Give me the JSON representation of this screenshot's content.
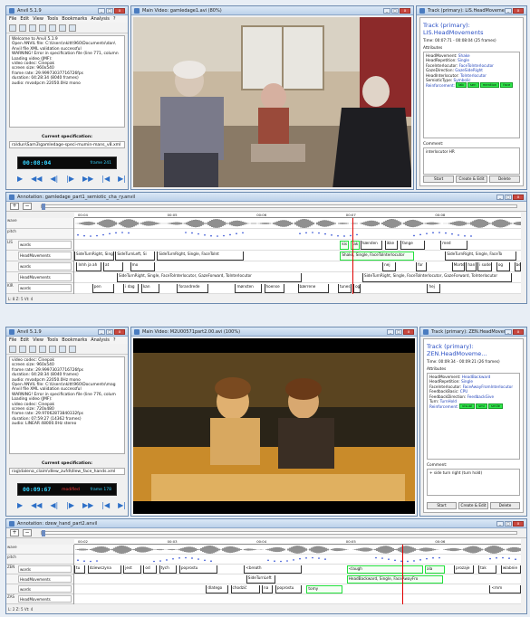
{
  "shots": [
    {
      "control": {
        "title": "Anvil 5.1.9",
        "menu": [
          "File",
          "Edit",
          "View",
          "Tools",
          "Bookmarks",
          "Analysis",
          "?"
        ],
        "log": [
          "Welcome to Anvil 5.1.9",
          "Open ANVIL file: C:\\Users\\nkitt\\960\\Documents\\dan\\",
          "  Anvil file XML validation successful",
          "WARNING! Error in specification file (line 771, column",
          "Loading video (JMF):",
          "   video codec: Cinepak",
          "   screen size: 960x540",
          "   frame rate: 29.99973037716726fps",
          "   duration: 04:28:34 (8040 frames)",
          "   audio: mvadpcm 22050.0Hz mono"
        ],
        "spec_caption": "Current specification:",
        "spec_path": "ra\\dun\\Sam3\\gamledage-speci-mumin-mans_v8.xml",
        "timecode": "00:08:04",
        "frame": "frame 241",
        "status": "",
        "controls": [
          "▶",
          "◀◀",
          "◀|",
          "|▶",
          "▶▶",
          "|◀",
          "▶|"
        ]
      },
      "video": {
        "title": "Main Video: gamledage1.avi (80%)",
        "palette": [
          "#b8a890",
          "#7a6654",
          "#2e2a2a",
          "#d9d2c4",
          "#8c2a2a",
          "#555a66"
        ]
      },
      "track": {
        "title": "Track (primary): LIS.HeadMovements",
        "window_title": "Track (primary): LIS.HeadMovements",
        "time": "Time: 00:07:71 - 00:08:04 (25 frames)",
        "attributes_label": "Attributes",
        "attributes": [
          [
            "HeadMovement:",
            "Shake"
          ],
          [
            "HeadRepetition:",
            "Single"
          ],
          [
            "FaceInterlocutor:",
            "FaceToInterlocutor"
          ],
          [
            "GazeDirection:",
            "GazeSideRight"
          ],
          [
            "HeadInterlocutor:",
            "ToInterlocutor"
          ],
          [
            "SemioticType:",
            "Symbolic"
          ]
        ],
        "reinforcement_label": "Reinforcement:",
        "reinforcement": [
          "lab",
          "sen",
          "mention",
          "face"
        ],
        "comment_label": "Comment:",
        "comment": "interlocutor HR",
        "buttons": [
          "Start",
          "Create & Edit",
          "Delete"
        ]
      },
      "annotation": {
        "title": "Annotation: gamledage_part1_semiotic_cha_ry.anvil",
        "ruler": [
          "00:04",
          "00:05",
          "00:06",
          "00:07",
          "00:08"
        ],
        "tiers": [
          {
            "id": "wave",
            "name": ""
          },
          {
            "id": "pitch",
            "name": ""
          },
          {
            "id": "LIS",
            "name": "words"
          },
          {
            "id": "",
            "name": "HeadMovements"
          },
          {
            "id": "",
            "name": "words"
          },
          {
            "id": "",
            "name": "HeadMovements"
          },
          {
            "id": "KIR",
            "name": "words"
          }
        ],
        "segments": [
          {
            "lane": 2,
            "s": 0.595,
            "e": 0.615,
            "t": "kis",
            "g": true
          },
          {
            "lane": 2,
            "s": 0.618,
            "e": 0.638,
            "t": "tak",
            "g": true
          },
          {
            "lane": 2,
            "s": 0.64,
            "e": 0.69,
            "t": "hænden",
            "g": false
          },
          {
            "lane": 2,
            "s": 0.695,
            "e": 0.725,
            "t": "ikke",
            "g": false
          },
          {
            "lane": 2,
            "s": 0.73,
            "e": 0.785,
            "t": "fange",
            "g": false
          },
          {
            "lane": 2,
            "s": 0.82,
            "e": 0.88,
            "t": "med",
            "g": false
          },
          {
            "lane": 3,
            "s": 0.0,
            "e": 0.09,
            "t": "SideTurnRight, Single",
            "g": false
          },
          {
            "lane": 3,
            "s": 0.092,
            "e": 0.18,
            "t": "SideTurnLeft, Si",
            "g": false
          },
          {
            "lane": 3,
            "s": 0.185,
            "e": 0.38,
            "t": "SideTurnRight, Single, FaceToInt",
            "g": false
          },
          {
            "lane": 3,
            "s": 0.595,
            "e": 0.76,
            "t": "Shake, Single, FaceToInterlocutor",
            "g": true
          },
          {
            "lane": 3,
            "s": 0.83,
            "e": 0.99,
            "t": "SideTurnRight, Single, FaceTo",
            "g": false
          },
          {
            "lane": 4,
            "s": 0.005,
            "e": 0.06,
            "t": "Inhh ja ah",
            "g": false
          },
          {
            "lane": 4,
            "s": 0.065,
            "e": 0.11,
            "t": "at",
            "g": false
          },
          {
            "lane": 4,
            "s": 0.125,
            "e": 0.18,
            "t": "mo",
            "g": false
          },
          {
            "lane": 4,
            "s": 0.69,
            "e": 0.72,
            "t": "nej",
            "g": false
          },
          {
            "lane": 4,
            "s": 0.765,
            "e": 0.79,
            "t": "for",
            "g": false
          },
          {
            "lane": 4,
            "s": 0.845,
            "e": 0.875,
            "t": "Morten",
            "g": false
          },
          {
            "lane": 4,
            "s": 0.877,
            "e": 0.9,
            "t": "han",
            "g": false
          },
          {
            "lane": 4,
            "s": 0.903,
            "e": 0.935,
            "t": "i sodet",
            "g": false
          },
          {
            "lane": 4,
            "s": 0.945,
            "e": 0.975,
            "t": "og",
            "g": false
          },
          {
            "lane": 4,
            "s": 0.985,
            "e": 1.0,
            "t": "behæ",
            "g": false
          },
          {
            "lane": 5,
            "s": 0.095,
            "e": 0.51,
            "t": "SideTurnRight, Single, FaceToInterlocutor, GazeForward, ToInterlocutor",
            "g": false
          },
          {
            "lane": 5,
            "s": 0.645,
            "e": 0.98,
            "t": "SideTurnRight, Single, FaceToInterlocutor, GazeForward, ToInterlocutor",
            "g": false
          },
          {
            "lane": 6,
            "s": 0.04,
            "e": 0.09,
            "t": "pen",
            "g": false
          },
          {
            "lane": 6,
            "s": 0.11,
            "e": 0.145,
            "t": "i dag",
            "g": false
          },
          {
            "lane": 6,
            "s": 0.15,
            "e": 0.19,
            "t": "kan",
            "g": false
          },
          {
            "lane": 6,
            "s": 0.23,
            "e": 0.3,
            "t": "forandrede",
            "g": false
          },
          {
            "lane": 6,
            "s": 0.36,
            "e": 0.42,
            "t": "mønsten",
            "g": false
          },
          {
            "lane": 6,
            "s": 0.425,
            "e": 0.47,
            "t": "hoense",
            "g": false
          },
          {
            "lane": 6,
            "s": 0.5,
            "e": 0.57,
            "t": "bærrene",
            "g": false
          },
          {
            "lane": 6,
            "s": 0.59,
            "e": 0.62,
            "t": "tunes",
            "g": false
          },
          {
            "lane": 6,
            "s": 0.625,
            "e": 0.64,
            "t": "og",
            "g": false
          },
          {
            "lane": 6,
            "s": 0.79,
            "e": 0.82,
            "t": "hej",
            "g": false
          }
        ],
        "cursor": 0.622,
        "status": "L: 8  Z: 5  Vt: 4"
      }
    },
    {
      "control": {
        "title": "Anvil 5.1.9",
        "menu": [
          "File",
          "Edit",
          "View",
          "Tools",
          "Bookmarks",
          "Analysis",
          "?"
        ],
        "log": [
          "   video codec: Cinepak",
          "   screen size: 960x540",
          "   frame rate: 29.99973037716726fps",
          "   duration: 04:28:34 (8040 frames)",
          "   audio: mvadpcm 22050.0Hz mono",
          "Open ANVIL file: C:\\Users\\nkitt\\960\\Documents\\mag",
          "  Anvil file XML validation successful",
          "WARNING! Error in specification file (line 776, colum",
          "Loading video (JMF):",
          "   video codec: Cinepak",
          "   screen size: 720x480",
          "   frame rate: 29.97062873840332fps",
          "   duration: 07:59:27 (14362 frames)",
          "   audio: LINEAR 48000.0Hz stereo"
        ],
        "spec_caption": "Current specification:",
        "spec_path": "rag\\dalena_claim\\dlew_zufd\\dlew_face_hands.xml",
        "timecode": "00:09:67",
        "frame": "frame 178",
        "status": "modified",
        "controls": [
          "▶",
          "◀◀",
          "◀|",
          "|▶",
          "▶▶",
          "|◀",
          "▶|"
        ]
      },
      "video": {
        "title": "Main Video: M2U00571part2.00.avi (100%)",
        "palette": [
          "#2a2418",
          "#7a5a1e",
          "#c98b2a",
          "#e0b060",
          "#3a2e24",
          "#8a7040"
        ]
      },
      "track": {
        "title": "Track (primary): ZEN.HeadMoveme...",
        "window_title": "Track (primary): ZEN.HeadMovements",
        "time": "Time: 00:09:34 - 00:09:21 (26 frames)",
        "attributes_label": "Attributes",
        "attributes": [
          [
            "HeadMovement:",
            "HeadBackward"
          ],
          [
            "HeadRepetition:",
            "Single"
          ],
          [
            "FaceInterlocutor:",
            "FaceAwayFromInterlocutor"
          ],
          [
            "FeedbackBasic:",
            "CPU"
          ],
          [
            "FeedbackDirection:",
            "FeedbackGive"
          ],
          [
            "Turn:",
            "TurnHold"
          ]
        ],
        "reinforcement_label": "Reinforcement:",
        "reinforcement": [
          "visual",
          "smi",
          "smile"
        ],
        "comment_label": "Comment:",
        "comment": "+ side turn right (turn hold)",
        "buttons": [
          "Start",
          "Create & Edit",
          "Delete"
        ]
      },
      "annotation": {
        "title": "Annotation: dzew_hand_part2.anvil",
        "ruler": [
          "00:02",
          "00:03",
          "00:04",
          "00:05",
          "00:06"
        ],
        "tiers": [
          {
            "id": "wave",
            "name": ""
          },
          {
            "id": "pitch",
            "name": ""
          },
          {
            "id": "ZEN",
            "name": "words"
          },
          {
            "id": "",
            "name": "HeadMovements"
          },
          {
            "id": "",
            "name": "words"
          },
          {
            "id": "ZAS",
            "name": "HeadMovements"
          }
        ],
        "segments": [
          {
            "lane": 2,
            "s": 0.0,
            "e": 0.025,
            "t": "tu",
            "g": false
          },
          {
            "lane": 2,
            "s": 0.03,
            "e": 0.105,
            "t": "dziewczyna",
            "g": false
          },
          {
            "lane": 2,
            "s": 0.11,
            "e": 0.15,
            "t": "jest",
            "g": false
          },
          {
            "lane": 2,
            "s": 0.155,
            "e": 0.185,
            "t": "od",
            "g": false
          },
          {
            "lane": 2,
            "s": 0.19,
            "e": 0.23,
            "t": "tych",
            "g": false
          },
          {
            "lane": 2,
            "s": 0.235,
            "e": 0.32,
            "t": "poprostu",
            "g": false
          },
          {
            "lane": 2,
            "s": 0.38,
            "e": 0.51,
            "t": "<breath",
            "g": false
          },
          {
            "lane": 2,
            "s": 0.61,
            "e": 0.78,
            "t": "<laugh",
            "g": true
          },
          {
            "lane": 2,
            "s": 0.785,
            "e": 0.83,
            "t": "ala",
            "g": true
          },
          {
            "lane": 2,
            "s": 0.85,
            "e": 0.895,
            "t": "prozaje",
            "g": false
          },
          {
            "lane": 2,
            "s": 0.905,
            "e": 0.945,
            "t": "tak",
            "g": false
          },
          {
            "lane": 2,
            "s": 0.955,
            "e": 1.0,
            "t": "wlabnie",
            "g": false
          },
          {
            "lane": 3,
            "s": 0.385,
            "e": 0.45,
            "t": "SideTurnLeft",
            "g": false
          },
          {
            "lane": 3,
            "s": 0.61,
            "e": 0.825,
            "t": "HeadBackward, Single, FaceAwayFro",
            "g": true
          },
          {
            "lane": 4,
            "s": 0.295,
            "e": 0.345,
            "t": "dlatego",
            "g": false
          },
          {
            "lane": 4,
            "s": 0.35,
            "e": 0.415,
            "t": "chodzić",
            "g": false
          },
          {
            "lane": 4,
            "s": 0.42,
            "e": 0.445,
            "t": "na",
            "g": false
          },
          {
            "lane": 4,
            "s": 0.45,
            "e": 0.51,
            "t": "poprostu",
            "g": false
          },
          {
            "lane": 4,
            "s": 0.52,
            "e": 0.6,
            "t": "tomy",
            "g": true
          },
          {
            "lane": 4,
            "s": 0.93,
            "e": 1.0,
            "t": "<mm",
            "g": false
          }
        ],
        "cursor": 0.735,
        "status": "L: 2  Z: 5  Vt: 4"
      }
    }
  ]
}
